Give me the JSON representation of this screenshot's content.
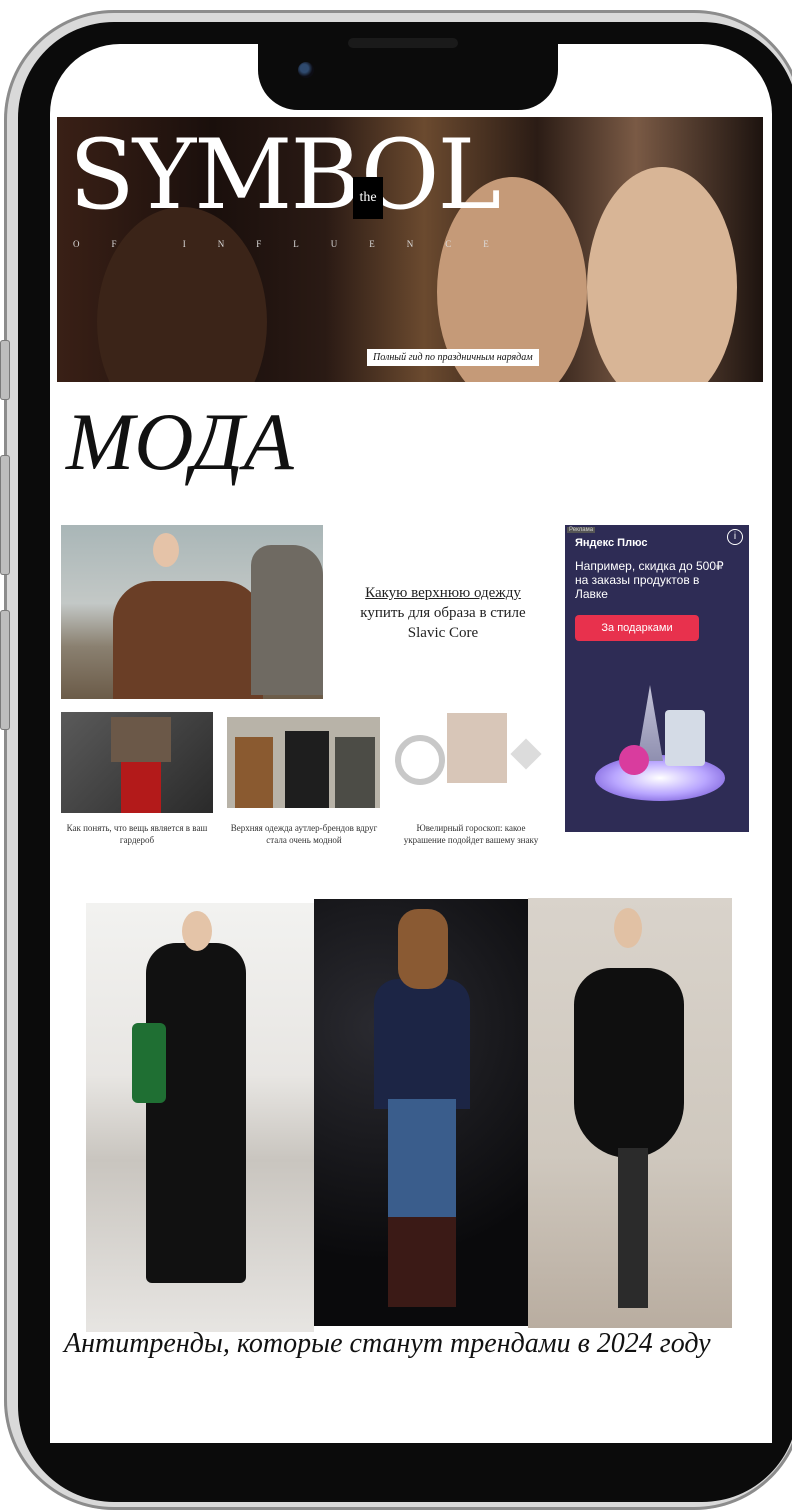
{
  "hero": {
    "title": "SYMBOL",
    "the": "the",
    "subtitle": "OF INFLUENCE",
    "caption": "Полный гид по праздничным нарядам"
  },
  "section": {
    "title": "МОДА"
  },
  "featured": {
    "line1": "Какую верхнюю одежду",
    "line2": "купить для образа в стиле",
    "line3": "Slavic Core"
  },
  "cards": [
    {
      "caption": "Как понять, что вещь является в ваш гардероб"
    },
    {
      "caption": "Верхняя одежда аутлер-брендов вдруг стала очень модной"
    },
    {
      "caption": "Ювелирный гороскоп: какое украшение подойдет вашему знаку"
    }
  ],
  "ad": {
    "tag": "Реклама",
    "brand": "Яндекс Плюс",
    "text": "Например, скидка до 500₽ на заказы продуктов в Лавке",
    "button": "За подарками",
    "info": "i"
  },
  "bottom": {
    "title": "Антитренды, которые станут трендами в 2024 году"
  }
}
